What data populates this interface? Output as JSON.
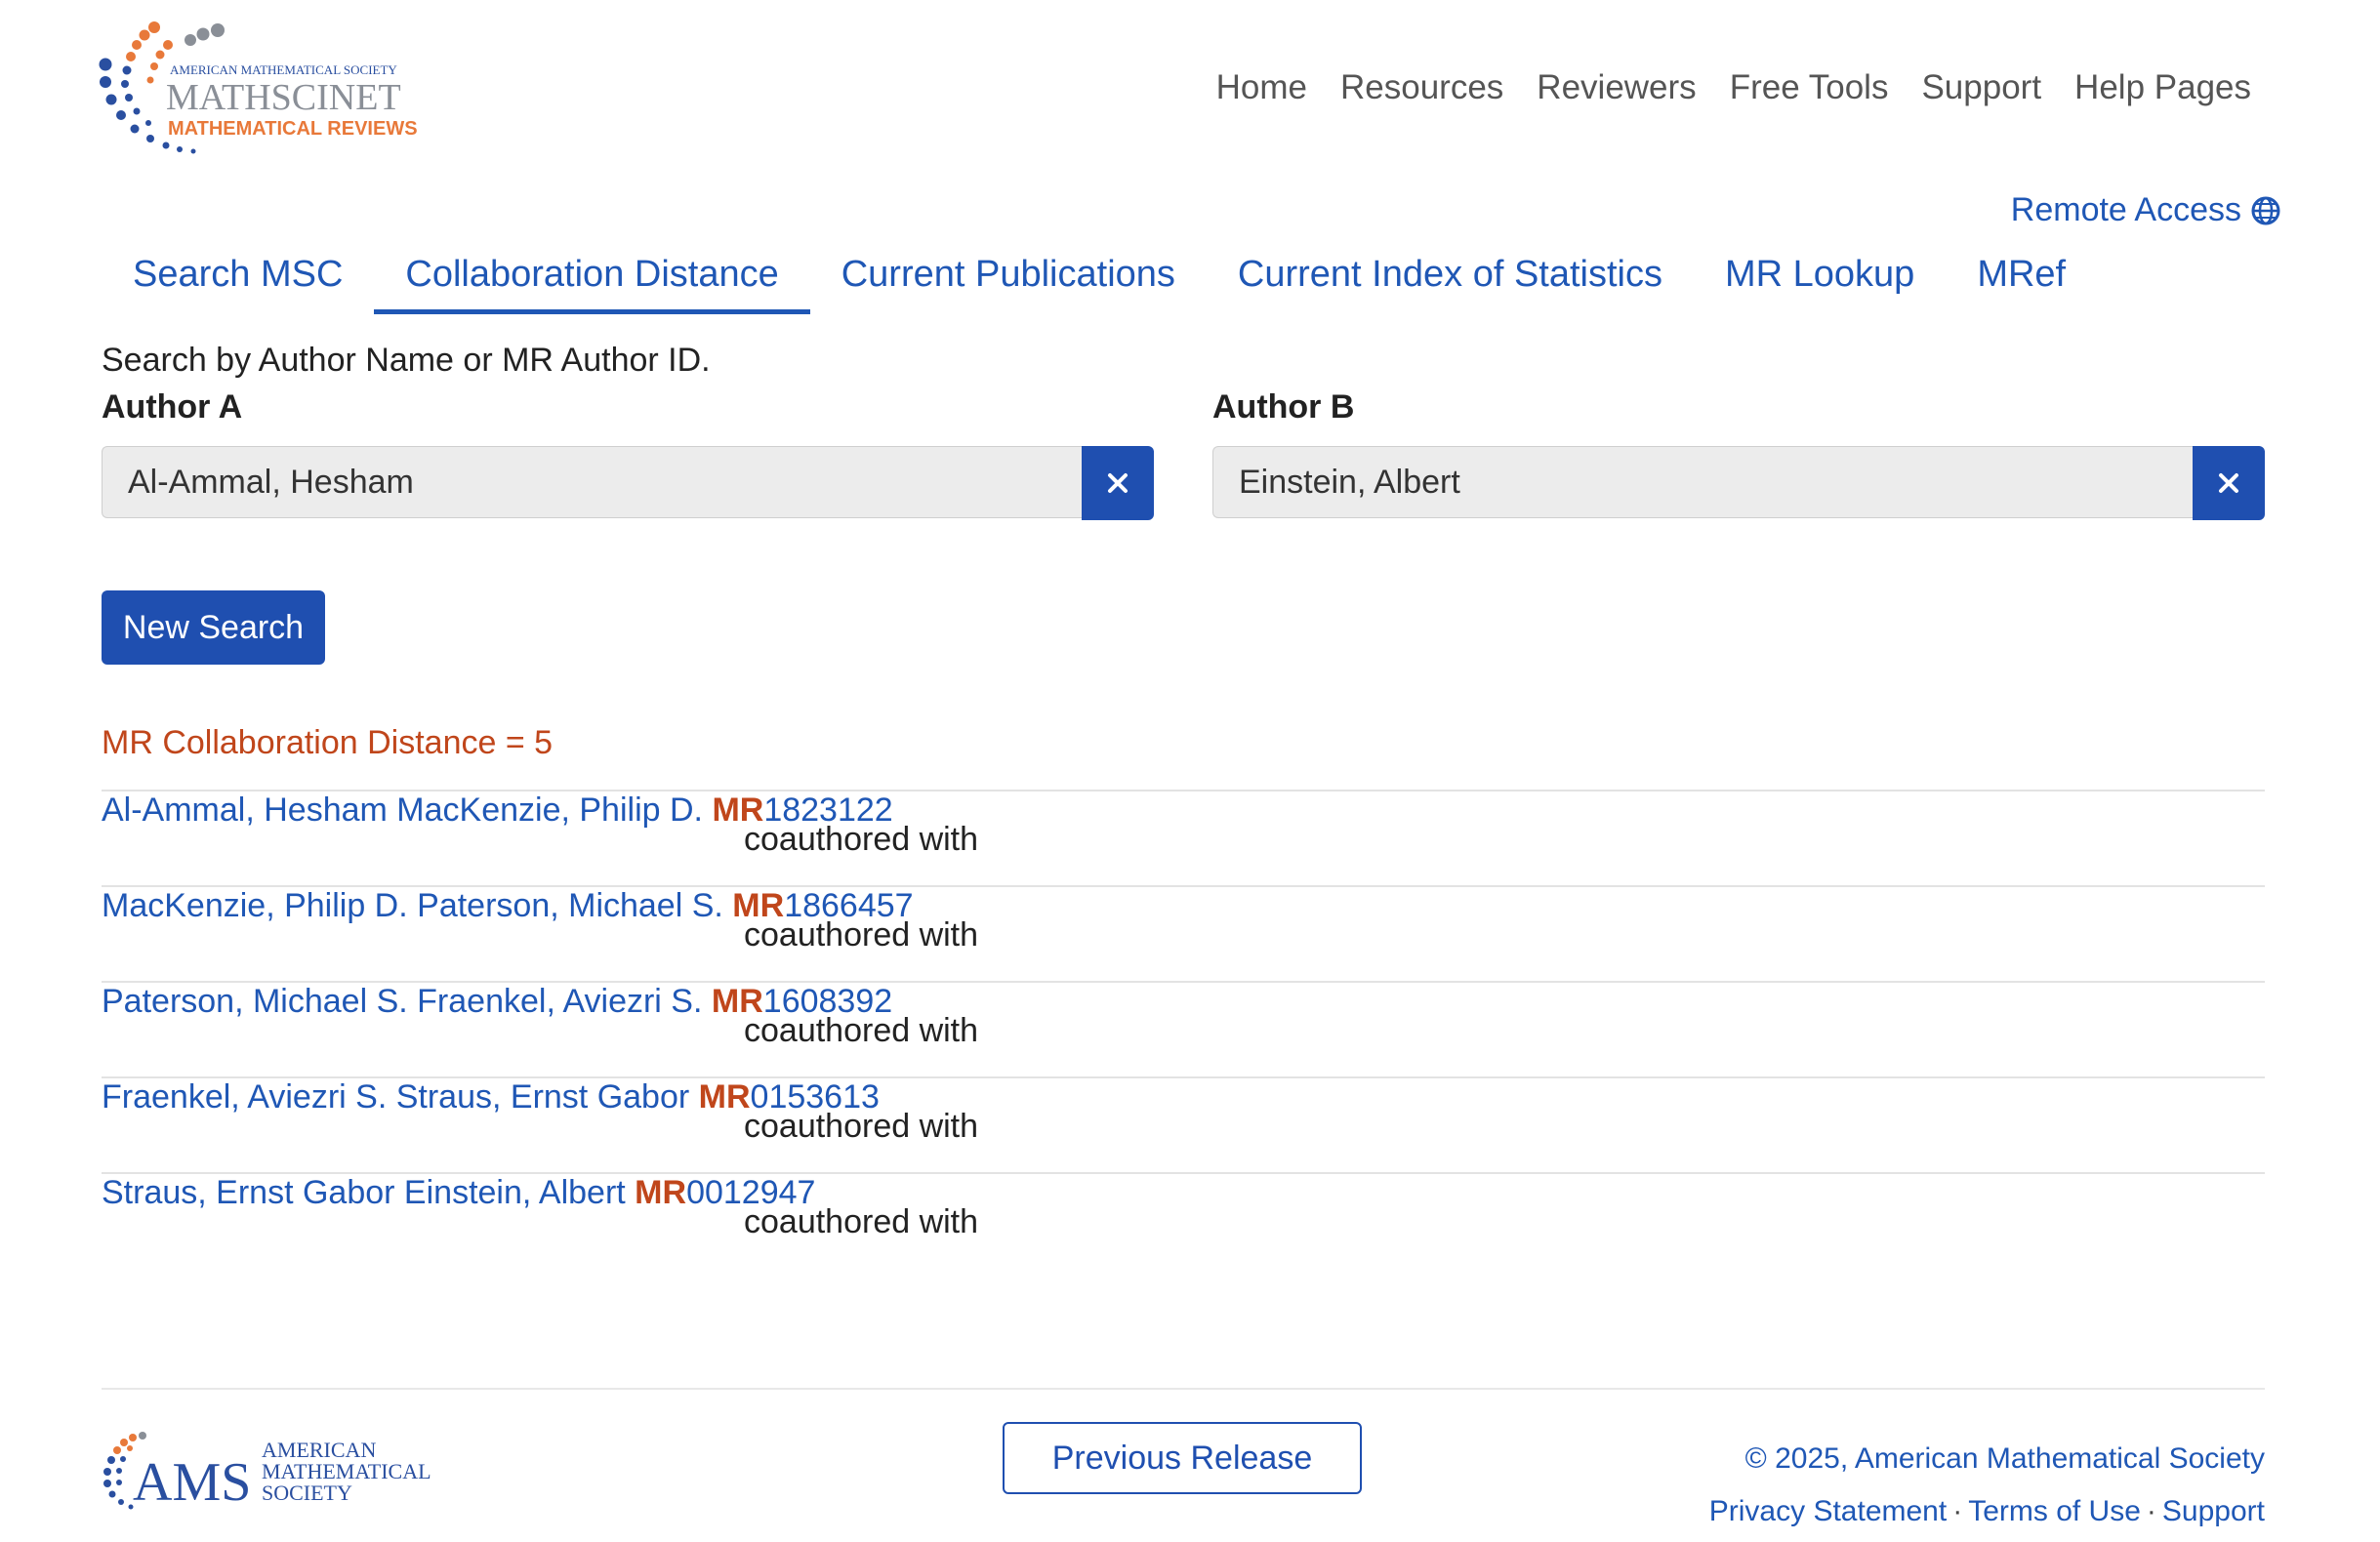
{
  "logo": {
    "line1": "AMERICAN MATHEMATICAL SOCIETY",
    "line2": "MATHSCINET",
    "line3": "MATHEMATICAL REVIEWS"
  },
  "topnav": [
    "Home",
    "Resources",
    "Reviewers",
    "Free Tools",
    "Support",
    "Help Pages"
  ],
  "remote_access": {
    "label": "Remote Access",
    "icon": "globe-icon"
  },
  "tabs": [
    {
      "label": "Search MSC",
      "active": false
    },
    {
      "label": "Collaboration Distance",
      "active": true
    },
    {
      "label": "Current Publications",
      "active": false
    },
    {
      "label": "Current Index of Statistics",
      "active": false
    },
    {
      "label": "MR Lookup",
      "active": false
    },
    {
      "label": "MRef",
      "active": false
    }
  ],
  "search": {
    "hint": "Search by Author Name or MR Author ID.",
    "author_a": {
      "label": "Author A",
      "value": "Al-Ammal, Hesham"
    },
    "author_b": {
      "label": "Author B",
      "value": "Einstein, Albert"
    },
    "new_search": "New Search"
  },
  "result": {
    "distance_text": "MR Collaboration Distance = 5",
    "rows": [
      {
        "from": "Al-Ammal, Hesham",
        "relation": "coauthored with",
        "to": "MacKenzie, Philip D.",
        "mr_prefix": "MR",
        "mr_number": "1823122"
      },
      {
        "from": "MacKenzie, Philip D.",
        "relation": "coauthored with",
        "to": "Paterson, Michael S.",
        "mr_prefix": "MR",
        "mr_number": "1866457"
      },
      {
        "from": "Paterson, Michael S.",
        "relation": "coauthored with",
        "to": "Fraenkel, Aviezri S.",
        "mr_prefix": "MR",
        "mr_number": "1608392"
      },
      {
        "from": "Fraenkel, Aviezri S.",
        "relation": "coauthored with",
        "to": "Straus, Ernst Gabor",
        "mr_prefix": "MR",
        "mr_number": "0153613"
      },
      {
        "from": "Straus, Ernst Gabor",
        "relation": "coauthored with",
        "to": "Einstein, Albert",
        "mr_prefix": "MR",
        "mr_number": "0012947"
      }
    ]
  },
  "footer": {
    "ams_logo": {
      "letters": "AMS",
      "line1": "AMERICAN",
      "line2": "MATHEMATICAL",
      "line3": "SOCIETY"
    },
    "previous_release": "Previous Release",
    "copyright": "© 2025, American Mathematical Society",
    "links": [
      "Privacy Statement",
      "Terms of Use",
      "Support"
    ]
  },
  "colors": {
    "link": "#1f57b5",
    "button": "#1f4fb0",
    "accent_orange": "#c0461b",
    "logo_orange": "#e8793a",
    "logo_blue": "#2a4fa0",
    "logo_gray": "#8a8f97"
  }
}
